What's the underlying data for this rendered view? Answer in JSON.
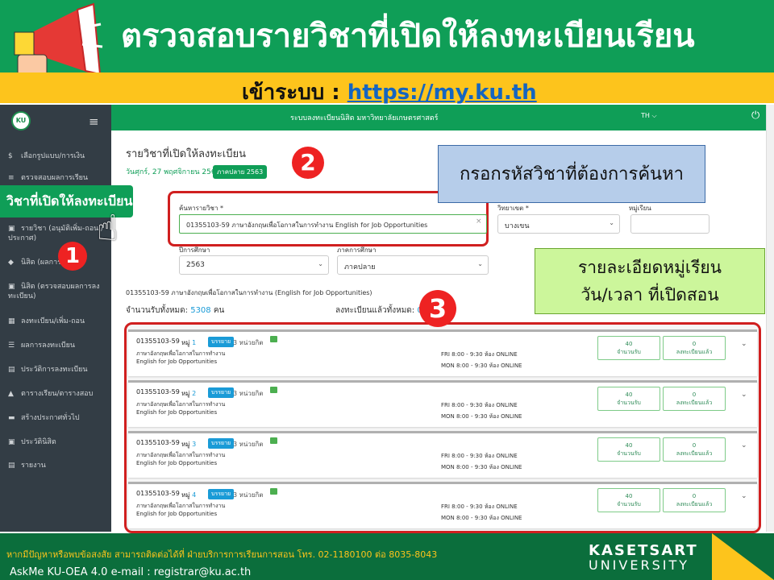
{
  "banner": {
    "title": "ตรวจสอบรายวิชาที่เปิดให้ลงทะเบียนเรียน",
    "login_prefix": "เข้าระบบ : ",
    "login_url": "https://my.ku.th"
  },
  "app": {
    "header_title": "ระบบลงทะเบียนนิสิต มหาวิทยาลัยเกษตรศาสตร์",
    "lang": "TH ⌵",
    "logo": "KU"
  },
  "sidebar": {
    "items": [
      {
        "label": "เลือกรูปแบบ/การเงิน",
        "icon": "$"
      },
      {
        "label": "ตรวจสอบผลการเรียน",
        "icon": "≡"
      },
      {
        "label": "รายวิชา (อนุมัติเพิ่ม-ถอน / ประกาศ)",
        "icon": "▣"
      },
      {
        "label": "นิสิต (ผลการเรียน)",
        "icon": "◆"
      },
      {
        "label": "นิสิต (ตรวจสอบผลการลงทะเบียน)",
        "icon": "▣"
      },
      {
        "label": "ลงทะเบียน/เพิ่ม-ถอน",
        "icon": "▦"
      },
      {
        "label": "ผลการลงทะเบียน",
        "icon": "☰"
      },
      {
        "label": "ประวัติการลงทะเบียน",
        "icon": "▤"
      },
      {
        "label": "ตารางเรียน/ตารางสอบ",
        "icon": "▲"
      },
      {
        "label": "สร้างประกาศทั่วไป",
        "icon": "▬"
      },
      {
        "label": "ประวัตินิสิต",
        "icon": "▣"
      },
      {
        "label": "รายงาน",
        "icon": "▤"
      }
    ],
    "active": "วิชาที่เปิดให้ลงทะเบียน"
  },
  "page": {
    "title": "รายวิชาที่เปิดให้ลงทะเบียน",
    "date": "วันศุกร์, 27 พฤศจิกายน 2563",
    "term_badge": "ภาคปลาย 2563"
  },
  "search": {
    "label": "ค้นหารายวิชา *",
    "value": "01355103-59 ภาษาอังกฤษเพื่อโอกาสในการทำงาน English for Job Opportunities",
    "clear": "×"
  },
  "filters": {
    "year_label": "ปีการศึกษา",
    "year": "2563",
    "sem_label": "ภาคการศึกษา",
    "sem": "ภาคปลาย",
    "campus_label": "วิทยาเขต *",
    "campus": "บางเขน",
    "section_label": "หมู่เรียน"
  },
  "course": {
    "name": "01355103-59 ภาษาอังกฤษเพื่อโอกาสในการทำงาน (English for Job Opportunities)",
    "quota_label": "จำนวนรับทั้งหมด:",
    "quota": "5308",
    "quota_unit": " คน",
    "enrolled_label": "ลงทะเบียนแล้วทั้งหมด:",
    "enrolled": "0"
  },
  "callouts": {
    "num1": "1",
    "num2": "2",
    "num3": "3",
    "search_hint": "กรอกรหัสวิชาที่ต้องการค้นหา",
    "detail_hint_1": "รายละเอียดหมู่เรียน",
    "detail_hint_2": "วัน/เวลา ที่เปิดสอน"
  },
  "sections": [
    {
      "code": "01355103-59",
      "sec_label": "หมู่",
      "sec": "1",
      "type": "บรรยาย",
      "credit": "3 หน่วยกิต",
      "th": "ภาษาอังกฤษเพื่อโอกาสในการทำงาน",
      "en": "English for Job Opportunities",
      "t1": "FRI 8:00 - 9:30   ห้อง ONLINE",
      "t2": "MON 8:00 - 9:30   ห้อง ONLINE",
      "quota": "40",
      "quota_label": "จำนวนรับ",
      "enrolled": "0",
      "enrolled_label": "ลงทะเบียนแล้ว"
    },
    {
      "code": "01355103-59",
      "sec_label": "หมู่",
      "sec": "2",
      "type": "บรรยาย",
      "credit": "3 หน่วยกิต",
      "th": "ภาษาอังกฤษเพื่อโอกาสในการทำงาน",
      "en": "English for Job Opportunities",
      "t1": "FRI 8:00 - 9:30   ห้อง ONLINE",
      "t2": "MON 8:00 - 9:30   ห้อง ONLINE",
      "quota": "40",
      "quota_label": "จำนวนรับ",
      "enrolled": "0",
      "enrolled_label": "ลงทะเบียนแล้ว"
    },
    {
      "code": "01355103-59",
      "sec_label": "หมู่",
      "sec": "3",
      "type": "บรรยาย",
      "credit": "3 หน่วยกิต",
      "th": "ภาษาอังกฤษเพื่อโอกาสในการทำงาน",
      "en": "English for Job Opportunities",
      "t1": "FRI 8:00 - 9:30   ห้อง ONLINE",
      "t2": "MON 8:00 - 9:30   ห้อง ONLINE",
      "quota": "40",
      "quota_label": "จำนวนรับ",
      "enrolled": "0",
      "enrolled_label": "ลงทะเบียนแล้ว"
    },
    {
      "code": "01355103-59",
      "sec_label": "หมู่",
      "sec": "4",
      "type": "บรรยาย",
      "credit": "3 หน่วยกิต",
      "th": "ภาษาอังกฤษเพื่อโอกาสในการทำงาน",
      "en": "English for Job Opportunities",
      "t1": "FRI 8:00 - 9:30   ห้อง ONLINE",
      "t2": "MON 8:00 - 9:30   ห้อง ONLINE",
      "quota": "40",
      "quota_label": "จำนวนรับ",
      "enrolled": "0",
      "enrolled_label": "ลงทะเบียนแล้ว"
    }
  ],
  "footer": {
    "contact": "หากมีปัญหาหรือพบข้อสงสัย สามารถติดต่อได้ที่ ฝ่ายบริการการเรียนการสอน โทร. 02-1180100 ต่อ 8035-8043",
    "askme": "AskMe KU-OEA 4.0   e-mail : registrar@ku.ac.th",
    "logo_1": "KASETSART",
    "logo_2": "UNIVERSITY"
  },
  "colors": {
    "green": "#0f9e57",
    "yellow": "#fdc41c",
    "red": "#d01f1f",
    "blue": "#1a9bd7"
  }
}
